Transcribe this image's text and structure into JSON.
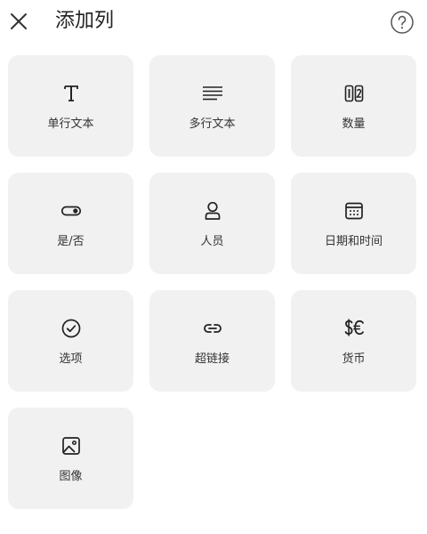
{
  "header": {
    "title": "添加列",
    "close_icon": "close-icon",
    "help_icon": "help-icon"
  },
  "column_types": [
    {
      "label": "单行文本",
      "icon": "text-T-icon"
    },
    {
      "label": "多行文本",
      "icon": "multiline-text-icon"
    },
    {
      "label": "数量",
      "icon": "number-icon"
    },
    {
      "label": "是/否",
      "icon": "toggle-icon"
    },
    {
      "label": "人员",
      "icon": "person-icon"
    },
    {
      "label": "日期和时间",
      "icon": "calendar-icon"
    },
    {
      "label": "选项",
      "icon": "check-circle-icon"
    },
    {
      "label": "超链接",
      "icon": "link-icon"
    },
    {
      "label": "货币",
      "icon": "currency-icon"
    },
    {
      "label": "图像",
      "icon": "image-icon"
    }
  ],
  "colors": {
    "tile_background": "#f1f1f1",
    "text": "#222222",
    "icon_stroke": "#222222"
  }
}
